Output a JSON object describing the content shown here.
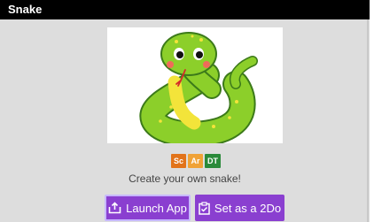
{
  "window": {
    "title": "Snake"
  },
  "app": {
    "image_alt": "Cartoon green snake",
    "tags": [
      "Sc",
      "Ar",
      "DT"
    ],
    "description": "Create your own snake!"
  },
  "buttons": {
    "launch_label": "Launch App",
    "todo_label": "Set as a 2Do"
  },
  "colors": {
    "button_bg": "#8a3fd0",
    "tag_sc": "#e2731a",
    "tag_ar": "#f0a236",
    "tag_dt": "#2a8a3a"
  }
}
